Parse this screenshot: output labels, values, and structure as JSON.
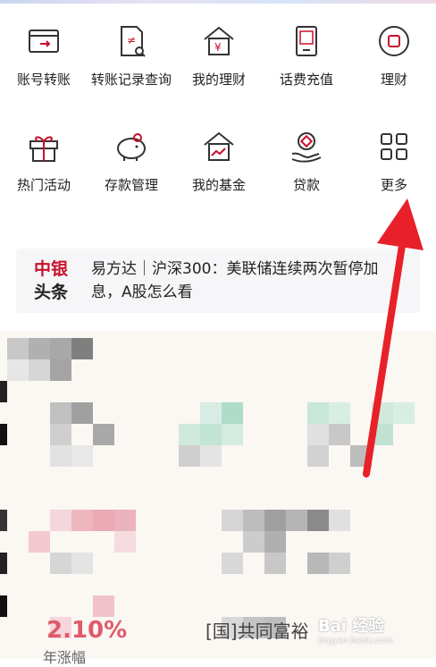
{
  "quick_menu": {
    "row1": [
      {
        "label": "账号转账",
        "icon": "transfer-card-icon"
      },
      {
        "label": "转账记录查询",
        "icon": "transfer-record-icon"
      },
      {
        "label": "我的理财",
        "icon": "wealth-house-icon"
      },
      {
        "label": "话费充值",
        "icon": "phone-recharge-icon"
      },
      {
        "label": "理财",
        "icon": "finance-circle-icon"
      }
    ],
    "row2": [
      {
        "label": "热门活动",
        "icon": "gift-icon"
      },
      {
        "label": "存款管理",
        "icon": "piggy-bank-icon"
      },
      {
        "label": "我的基金",
        "icon": "fund-chart-icon"
      },
      {
        "label": "贷款",
        "icon": "loan-hand-icon"
      },
      {
        "label": "更多",
        "icon": "more-grid-icon"
      }
    ]
  },
  "news": {
    "logo_line1": "中银",
    "logo_line2": "头条",
    "text": "易方达｜沪深300：美联储连续两次暂停加息，A股怎么看"
  },
  "partial": {
    "number": "2.10%",
    "title": "[国]共同富裕",
    "sub": "年涨幅"
  },
  "watermark": {
    "main": "Bai 经验",
    "sub": "jingyan.baidu.com"
  },
  "colors": {
    "accent": "#c8102e",
    "arrow": "#e8202a"
  }
}
